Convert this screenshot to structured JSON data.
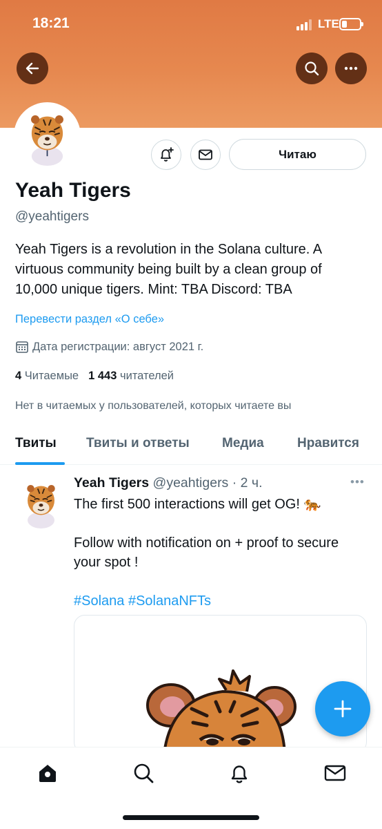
{
  "status_bar": {
    "time": "18:21",
    "network": "LTE"
  },
  "header": {
    "back_icon": "arrow-left-icon",
    "search_icon": "search-icon",
    "more_icon": "more-horizontal-icon",
    "banner_color": "#e6884f"
  },
  "profile": {
    "name": "Yeah Tigers",
    "handle": "@yeahtigers",
    "bio": "Yeah Tigers is a revolution in the Solana culture. A virtuous community being built by a clean group of 10,000 unique tigers. Mint: TBA Discord: TBA",
    "translate_link": "Перевести раздел «О себе»",
    "joined": "Дата регистрации: август 2021 г.",
    "following_count": "4",
    "following_label": "Читаемые",
    "followers_count": "1 443",
    "followers_label": "читателей",
    "followed_by": "Нет в читаемых у пользователей, которых читаете вы",
    "follow_button": "Читаю"
  },
  "tabs": [
    {
      "label": "Твиты",
      "active": true
    },
    {
      "label": "Твиты и ответы",
      "active": false
    },
    {
      "label": "Медиа",
      "active": false
    },
    {
      "label": "Нравится",
      "active": false
    }
  ],
  "tweet": {
    "name": "Yeah Tigers",
    "handle": "@yeahtigers",
    "separator": "·",
    "time": "2 ч.",
    "line1": "The first 500 interactions will get OG! 🐅",
    "line2": "Follow with notification on + proof to secure your spot !",
    "hashtags": "#Solana #SolanaNFTs"
  },
  "bottom_nav": [
    "home-icon",
    "search-icon",
    "notifications-bell-icon",
    "messages-envelope-icon"
  ],
  "colors": {
    "accent": "#1d9bf0",
    "text": "#0f1419",
    "secondary": "#536471"
  }
}
